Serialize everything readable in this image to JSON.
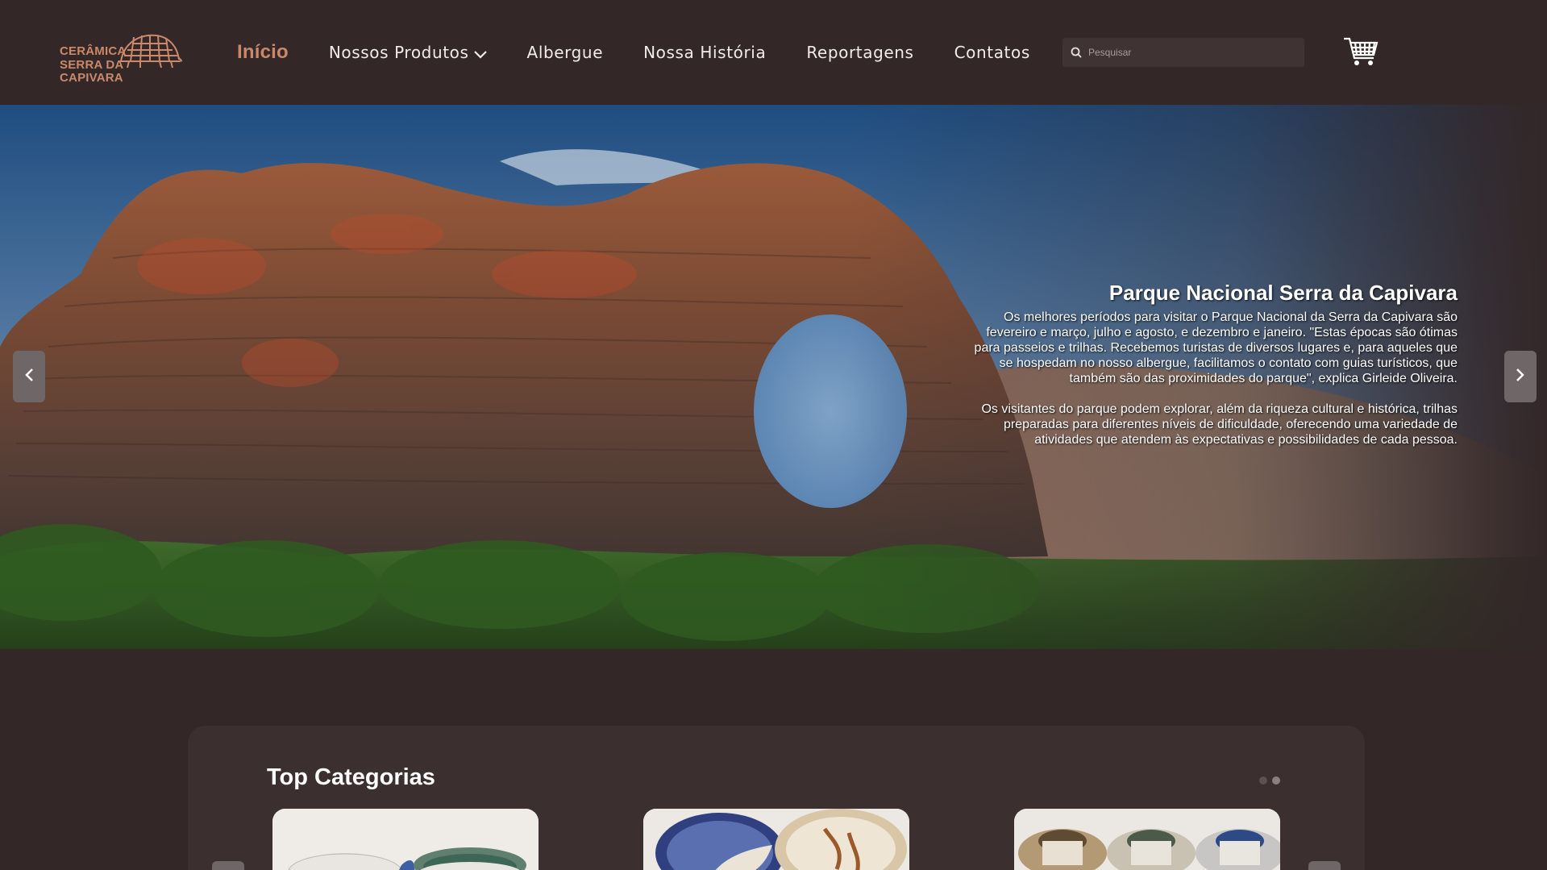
{
  "logo": {
    "line1": "CERÂMICA",
    "line2": "SERRA DA CAPIVARA"
  },
  "nav": {
    "items": [
      {
        "label": "Início",
        "active": true
      },
      {
        "label": "Nossos Produtos",
        "dropdown": true
      },
      {
        "label": "Albergue"
      },
      {
        "label": "Nossa História"
      },
      {
        "label": "Reportagens"
      },
      {
        "label": "Contatos"
      }
    ]
  },
  "search": {
    "placeholder": "Pesquisar",
    "icon": "search-icon"
  },
  "cart": {
    "icon": "shopping-cart-icon"
  },
  "hero": {
    "title": "Parque Nacional Serra da Capivara",
    "paragraph1": "Os melhores períodos para visitar o Parque Nacional da Serra da Capivara são fevereiro e março, julho e agosto, e dezembro e janeiro. \"Estas épocas são ótimas para passeios e trilhas. Recebemos turistas de diversos lugares e, para aqueles que se hospedam no nosso albergue, facilitamos o contato com guias turísticos, que também são das proximidades do parque\", explica Girleide Oliveira.",
    "paragraph2": "Os visitantes do parque podem explorar, além da riqueza cultural e histórica, trilhas preparadas para diferentes níveis de dificuldade, oferecendo uma variedade de atividades que atendem às expectativas e possibilidades de cada pessoa.",
    "prev_icon": "chevron-left-icon",
    "next_icon": "chevron-right-icon"
  },
  "categories": {
    "title": "Top Categorias",
    "page_dots": 2,
    "active_dot": 1
  },
  "colors": {
    "background": "#332728",
    "accent": "#c9896a",
    "panel": "#3b2f30"
  }
}
